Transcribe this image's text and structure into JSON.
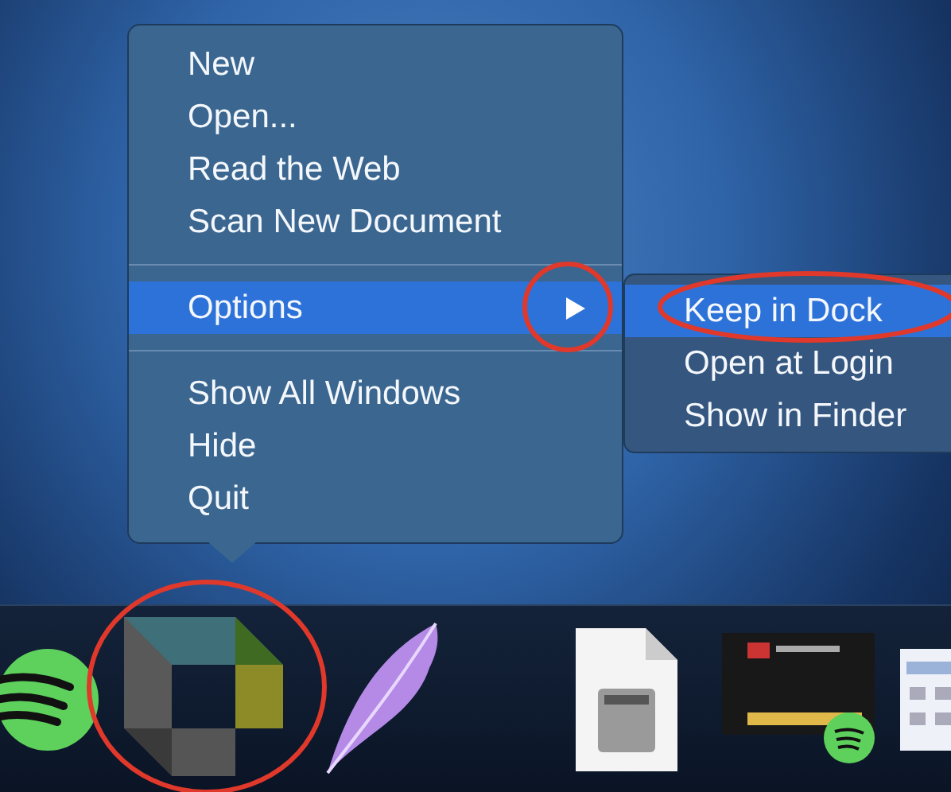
{
  "menu": {
    "groups": [
      {
        "items": [
          {
            "label": "New",
            "selected": false,
            "has_submenu": false
          },
          {
            "label": "Open...",
            "selected": false,
            "has_submenu": false
          },
          {
            "label": "Read the Web",
            "selected": false,
            "has_submenu": false
          },
          {
            "label": "Scan New Document",
            "selected": false,
            "has_submenu": false
          }
        ]
      },
      {
        "items": [
          {
            "label": "Options",
            "selected": true,
            "has_submenu": true
          }
        ]
      },
      {
        "items": [
          {
            "label": "Show All Windows",
            "selected": false,
            "has_submenu": false
          },
          {
            "label": "Hide",
            "selected": false,
            "has_submenu": false
          },
          {
            "label": "Quit",
            "selected": false,
            "has_submenu": false
          }
        ]
      }
    ]
  },
  "submenu": {
    "items": [
      {
        "label": "Keep in Dock",
        "selected": true
      },
      {
        "label": "Open at Login",
        "selected": false
      },
      {
        "label": "Show in Finder",
        "selected": false
      }
    ]
  }
}
